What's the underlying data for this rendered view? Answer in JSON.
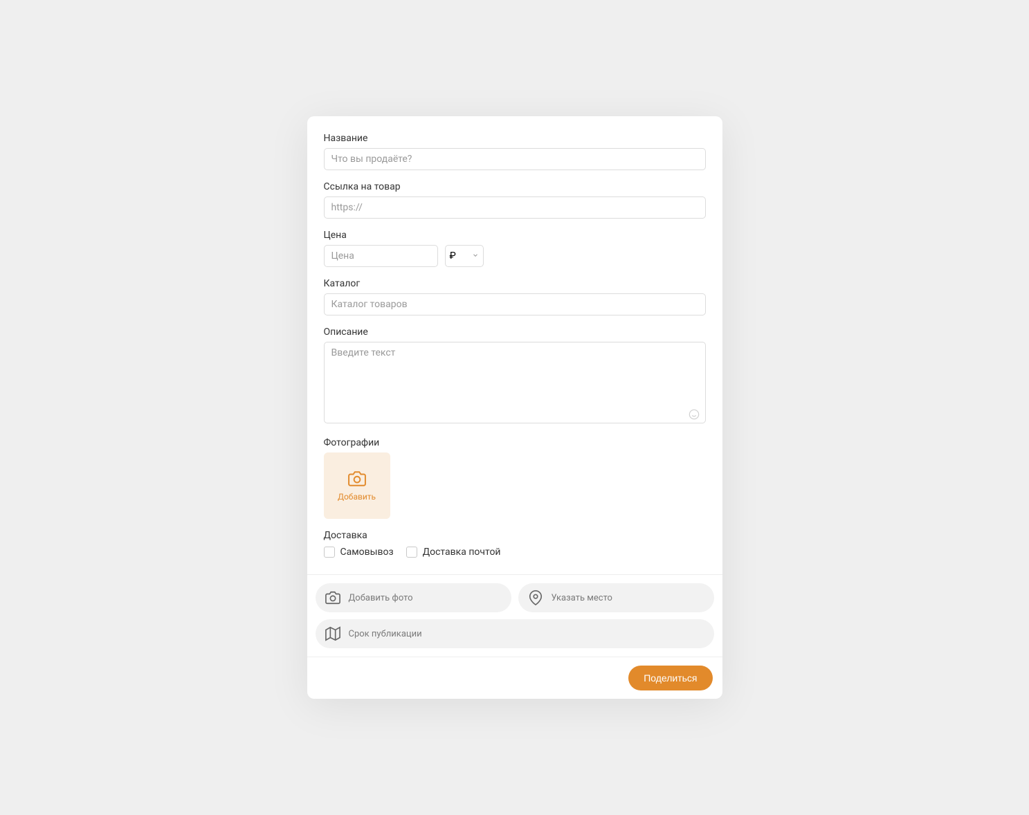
{
  "fields": {
    "name": {
      "label": "Название",
      "placeholder": "Что вы продаёте?"
    },
    "link": {
      "label": "Ссылка на товар",
      "placeholder": "https://"
    },
    "price": {
      "label": "Цена",
      "placeholder": "Цена",
      "currency": "₽"
    },
    "catalog": {
      "label": "Каталог",
      "placeholder": "Каталог товаров"
    },
    "description": {
      "label": "Описание",
      "placeholder": "Введите текст"
    },
    "photos": {
      "label": "Фотографии",
      "add_label": "Добавить"
    },
    "delivery": {
      "label": "Доставка",
      "pickup_label": "Самовывоз",
      "postal_label": "Доставка почтой"
    }
  },
  "actions": {
    "add_photo": "Добавить фото",
    "location": "Указать место",
    "schedule": "Срок публикации"
  },
  "submit_label": "Поделиться"
}
